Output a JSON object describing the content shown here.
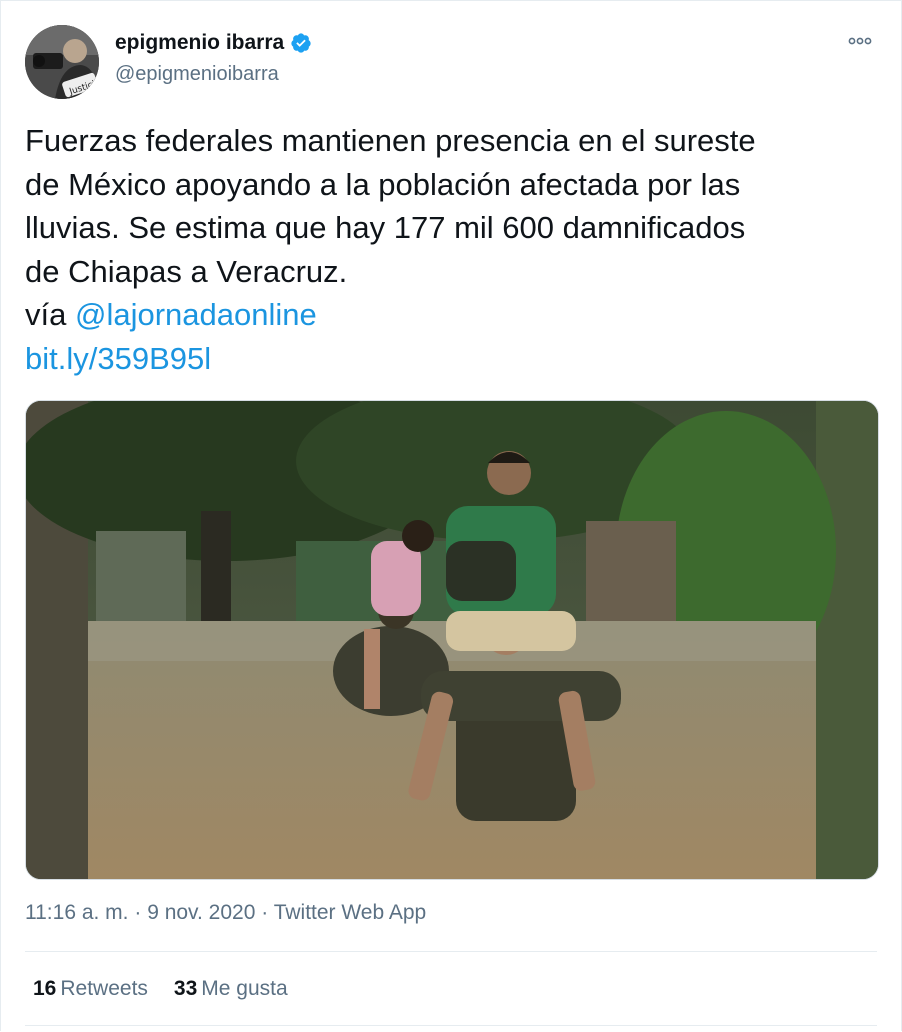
{
  "tweet": {
    "author_name": "epigmenio ibarra",
    "author_handle": "@epigmenioibarra",
    "avatar_stamp": "Justicia",
    "verified": true,
    "text_lines": [
      "Fuerzas federales mantienen presencia en el sureste",
      "de México apoyando a la población afectada por las",
      "lluvias. Se estima que hay 177 mil 600 damnificados",
      "de Chiapas a Veracruz."
    ],
    "via_prefix": "vía ",
    "mention": "@lajornadaonline",
    "short_link": "bit.ly/359B95l",
    "timestamp": "11:16 a. m.",
    "separator": " · ",
    "date": "9 nov. 2020",
    "source": "Twitter Web App",
    "retweets_count": "16",
    "retweets_label": "Retweets",
    "likes_count": "33",
    "likes_label": "Me gusta"
  },
  "colors": {
    "link": "#1b95e0",
    "secondary_text": "#5b7083",
    "verified_badge": "#1da1f2",
    "divider": "#e6ecf0"
  },
  "icons": {
    "verified": "verified-badge-icon",
    "more": "more-options-icon"
  }
}
